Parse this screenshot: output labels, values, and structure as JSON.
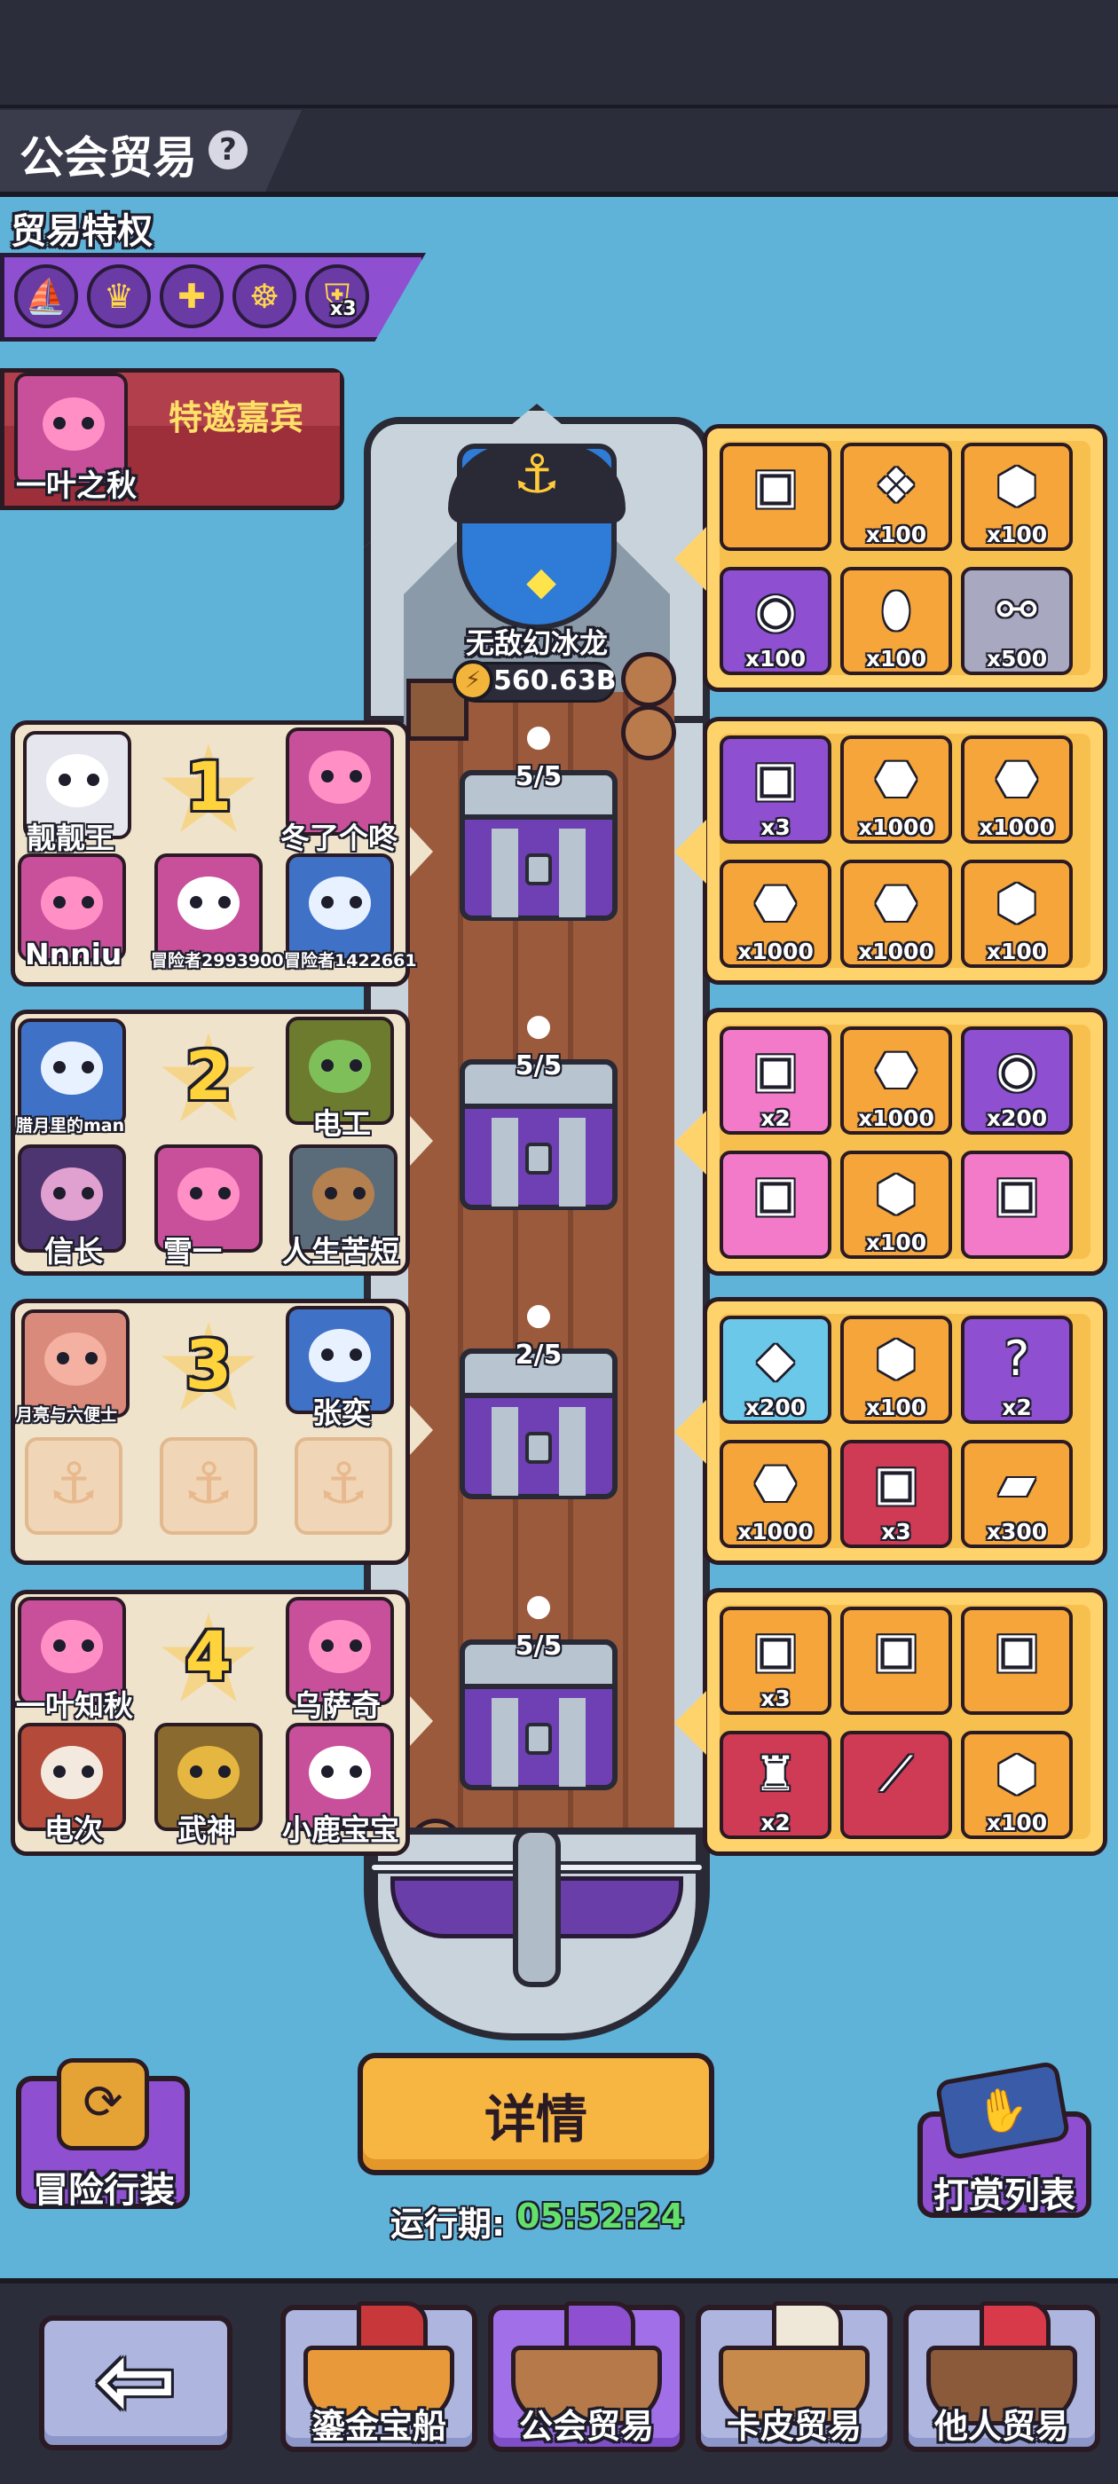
{
  "header": {
    "title": "公会贸易",
    "help_icon": "?"
  },
  "privilege": {
    "label": "贸易特权",
    "icons": [
      {
        "name": "ship-speed-icon",
        "glyph": "⛵"
      },
      {
        "name": "crown-badge-icon",
        "glyph": "♛"
      },
      {
        "name": "target-icon",
        "glyph": "✚"
      },
      {
        "name": "vip-wheel-icon",
        "glyph": "☸"
      },
      {
        "name": "shield-x3-icon",
        "glyph": "⛨",
        "badge": "x3"
      }
    ]
  },
  "guest": {
    "title": "特邀嘉宾",
    "name": "一叶之秋"
  },
  "captain": {
    "name": "无敌幻冰龙",
    "power": "560.63B"
  },
  "teams": [
    {
      "rank": "1",
      "chest": "5/5",
      "members": [
        "靓靓王",
        "冬了个咚",
        "Nnniu",
        "冒险者2993900",
        "冒险者1422661"
      ]
    },
    {
      "rank": "2",
      "chest": "5/5",
      "members": [
        "腊月里的man",
        "电工",
        "信长",
        "雪一",
        "人生苦短"
      ]
    },
    {
      "rank": "3",
      "chest": "2/5",
      "members": [
        "月亮与六便士",
        "张奕"
      ]
    },
    {
      "rank": "4",
      "chest": "5/5",
      "members": [
        "一叶知秋",
        "乌萨奇",
        "电次",
        "武神",
        "小鹿宝宝"
      ]
    }
  ],
  "rewards": [
    [
      {
        "icon": "golden-chest-icon",
        "glyph": "▣",
        "qty": "",
        "color": "orange"
      },
      {
        "icon": "paw-badge-icon",
        "glyph": "❖",
        "qty": "x100",
        "color": "orange"
      },
      {
        "icon": "green-gem-icon",
        "glyph": "⬢",
        "qty": "x100",
        "color": "orange"
      },
      {
        "icon": "guild-coin-icon",
        "glyph": "◉",
        "qty": "x100",
        "color": "purple"
      },
      {
        "icon": "egg-icon",
        "glyph": "⬮",
        "qty": "x100",
        "color": "orange"
      },
      {
        "icon": "bone-icon",
        "glyph": "⚯",
        "qty": "x500",
        "color": "grey"
      }
    ],
    [
      {
        "icon": "armor-chest-icon",
        "glyph": "▣",
        "qty": "x3",
        "color": "purple"
      },
      {
        "icon": "hex-token-icon",
        "glyph": "⬣",
        "qty": "x1000",
        "color": "orange"
      },
      {
        "icon": "hex-token-icon",
        "glyph": "⬣",
        "qty": "x1000",
        "color": "orange"
      },
      {
        "icon": "hex-token-icon",
        "glyph": "⬣",
        "qty": "x1000",
        "color": "orange"
      },
      {
        "icon": "hex-token-icon",
        "glyph": "⬣",
        "qty": "x1000",
        "color": "orange"
      },
      {
        "icon": "purple-gem-icon",
        "glyph": "⬢",
        "qty": "x100",
        "color": "orange"
      }
    ],
    [
      {
        "icon": "pink-chest-icon",
        "glyph": "▣",
        "qty": "x2",
        "color": "pink"
      },
      {
        "icon": "hex-token-icon",
        "glyph": "⬣",
        "qty": "x1000",
        "color": "orange"
      },
      {
        "icon": "guild-coin-icon",
        "glyph": "◉",
        "qty": "x200",
        "color": "purple"
      },
      {
        "icon": "pink-chest-icon",
        "glyph": "▣",
        "qty": "",
        "color": "pink"
      },
      {
        "icon": "purple-gem-icon",
        "glyph": "⬢",
        "qty": "x100",
        "color": "orange"
      },
      {
        "icon": "pink-chest-icon",
        "glyph": "▣",
        "qty": "",
        "color": "pink"
      }
    ],
    [
      {
        "icon": "crystal-icon",
        "glyph": "◆",
        "qty": "x200",
        "color": "teal"
      },
      {
        "icon": "purple-gem-icon",
        "glyph": "⬢",
        "qty": "x100",
        "color": "orange"
      },
      {
        "icon": "mystery-chest-icon",
        "glyph": "?",
        "qty": "x2",
        "color": "purple"
      },
      {
        "icon": "hex-token-icon",
        "glyph": "⬣",
        "qty": "x1000",
        "color": "orange"
      },
      {
        "icon": "red-chest-icon",
        "glyph": "▣",
        "qty": "x3",
        "color": "red"
      },
      {
        "icon": "ticket-icon",
        "glyph": "▰",
        "qty": "x300",
        "color": "orange"
      }
    ],
    [
      {
        "icon": "golden-chest-icon",
        "glyph": "▣",
        "qty": "x3",
        "color": "orange"
      },
      {
        "icon": "golden-chest-icon",
        "glyph": "▣",
        "qty": "",
        "color": "orange"
      },
      {
        "icon": "golden-chest-icon",
        "glyph": "▣",
        "qty": "",
        "color": "orange"
      },
      {
        "icon": "warrior-figure-icon",
        "glyph": "♜",
        "qty": "x2",
        "color": "red"
      },
      {
        "icon": "staff-weapon-icon",
        "glyph": "⟋",
        "qty": "",
        "color": "red"
      },
      {
        "icon": "purple-gem-icon",
        "glyph": "⬢",
        "qty": "x100",
        "color": "orange"
      }
    ]
  ],
  "actions": {
    "details": "详情",
    "runtime_label": "运行期:",
    "runtime_value": "05:52:24",
    "adventure": "冒险行装",
    "reward_list": "打赏列表"
  },
  "nav": {
    "back": "⇦",
    "tabs": [
      "鎏金宝船",
      "公会贸易",
      "卡皮贸易",
      "他人贸易"
    ],
    "active": "公会贸易"
  },
  "colors": {
    "background": "#5fb3d9",
    "panel_purple": "#8e4fd0",
    "reward_gold": "#f7bf4e",
    "runtime_green": "#63e06b",
    "button_gold": "#f7b541"
  }
}
